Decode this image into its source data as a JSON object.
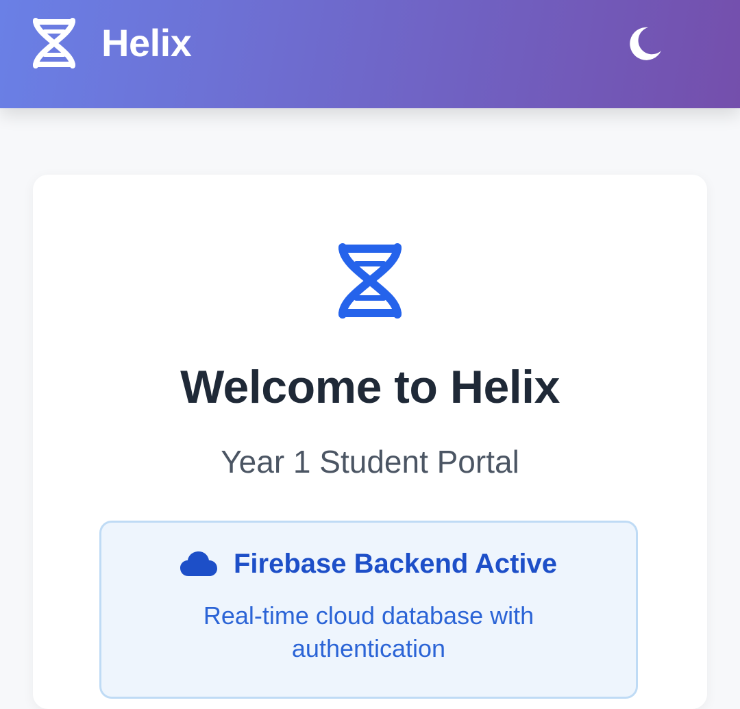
{
  "header": {
    "app_name": "Helix",
    "logo_icon": "dna-helix-icon",
    "theme_toggle_icon": "moon-icon"
  },
  "welcome_card": {
    "logo_icon": "dna-helix-icon",
    "title": "Welcome to Helix",
    "subtitle": "Year 1 Student Portal",
    "status": {
      "icon": "cloud-icon",
      "title": "Firebase Backend Active",
      "description": "Real-time cloud database with authentication"
    }
  },
  "colors": {
    "header_gradient_start": "#6a80e6",
    "header_gradient_end": "#744fac",
    "accent_blue": "#2563eb",
    "title_text": "#1f2937",
    "subtitle_text": "#4b5563",
    "status_bg": "#eef5fd",
    "status_border": "#bfdbf5",
    "status_title": "#1d4fc8"
  }
}
